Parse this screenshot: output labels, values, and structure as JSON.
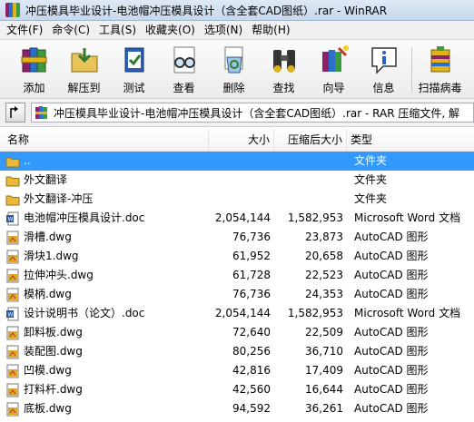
{
  "window": {
    "title": "冲压模具毕业设计-电池帽冲压模具设计（含全套CAD图纸）.rar - WinRAR"
  },
  "menu": [
    "文件(F)",
    "命令(C)",
    "工具(S)",
    "收藏夹(O)",
    "选项(N)",
    "帮助(H)"
  ],
  "toolbar": [
    {
      "label": "添加",
      "icon": "add-books-icon"
    },
    {
      "label": "解压到",
      "icon": "extract-folder-icon"
    },
    {
      "label": "测试",
      "icon": "test-clipboard-icon"
    },
    {
      "label": "查看",
      "icon": "view-glasses-icon"
    },
    {
      "label": "删除",
      "icon": "delete-recycle-icon"
    },
    {
      "label": "查找",
      "icon": "find-binoculars-icon"
    },
    {
      "label": "向导",
      "icon": "wizard-wand-icon"
    },
    {
      "label": "信息",
      "icon": "info-icon"
    },
    {
      "label": "扫描病毒",
      "icon": "virus-scan-icon"
    }
  ],
  "address": {
    "path": "冲压模具毕业设计-电池帽冲压模具设计（含全套CAD图纸）.rar - RAR 压缩文件, 解"
  },
  "columns": {
    "name": "名称",
    "size": "大小",
    "packed": "压缩后大小",
    "type": "类型"
  },
  "files": [
    {
      "name": "..",
      "size": "",
      "packed": "",
      "type": "文件夹",
      "kind": "folder",
      "selected": true
    },
    {
      "name": "外文翻译",
      "size": "",
      "packed": "",
      "type": "文件夹",
      "kind": "folder"
    },
    {
      "name": "外文翻译-冲压",
      "size": "",
      "packed": "",
      "type": "文件夹",
      "kind": "folder"
    },
    {
      "name": "电池帽冲压模具设计.doc",
      "size": "2,054,144",
      "packed": "1,582,953",
      "type": "Microsoft Word 文档",
      "kind": "doc"
    },
    {
      "name": "滑槽.dwg",
      "size": "76,736",
      "packed": "23,873",
      "type": "AutoCAD 图形",
      "kind": "dwg"
    },
    {
      "name": "滑块1.dwg",
      "size": "61,952",
      "packed": "20,658",
      "type": "AutoCAD 图形",
      "kind": "dwg"
    },
    {
      "name": "拉伸冲头.dwg",
      "size": "61,728",
      "packed": "22,523",
      "type": "AutoCAD 图形",
      "kind": "dwg"
    },
    {
      "name": "模柄.dwg",
      "size": "76,736",
      "packed": "24,353",
      "type": "AutoCAD 图形",
      "kind": "dwg"
    },
    {
      "name": "设计说明书（论文）.doc",
      "size": "2,054,144",
      "packed": "1,582,953",
      "type": "Microsoft Word 文档",
      "kind": "doc"
    },
    {
      "name": "卸料板.dwg",
      "size": "72,640",
      "packed": "22,509",
      "type": "AutoCAD 图形",
      "kind": "dwg"
    },
    {
      "name": "装配图.dwg",
      "size": "80,256",
      "packed": "36,710",
      "type": "AutoCAD 图形",
      "kind": "dwg"
    },
    {
      "name": "凹模.dwg",
      "size": "42,816",
      "packed": "17,409",
      "type": "AutoCAD 图形",
      "kind": "dwg"
    },
    {
      "name": "打料杆.dwg",
      "size": "42,560",
      "packed": "16,644",
      "type": "AutoCAD 图形",
      "kind": "dwg"
    },
    {
      "name": "底板.dwg",
      "size": "94,592",
      "packed": "36,261",
      "type": "AutoCAD 图形",
      "kind": "dwg"
    }
  ],
  "colors": {
    "selection": "#3399ff",
    "folder": "#e8b93c",
    "dwg": "#e0a92a",
    "doc": "#2b579a"
  }
}
